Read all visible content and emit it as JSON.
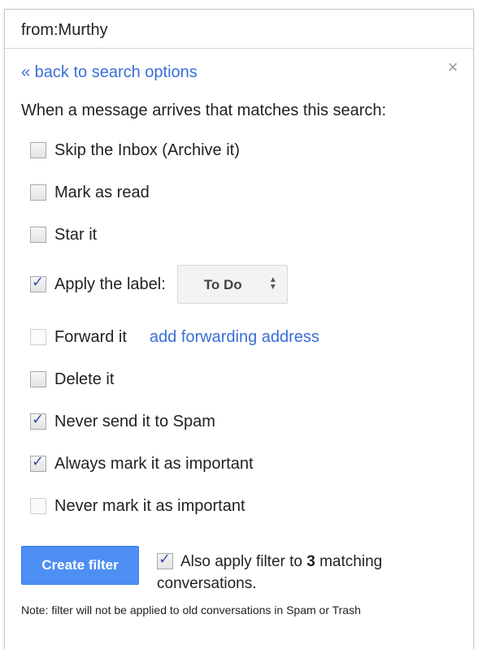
{
  "search": {
    "query": "from:Murthy"
  },
  "header": {
    "back_link": "« back to search options",
    "close_glyph": "×"
  },
  "intro_text": "When a message arrives that matches this search:",
  "options": [
    {
      "label": "Skip the Inbox (Archive it)",
      "checked": false
    },
    {
      "label": "Mark as read",
      "checked": false
    },
    {
      "label": "Star it",
      "checked": false
    },
    {
      "label": "Apply the label:",
      "checked": true
    },
    {
      "label": "Forward it",
      "checked": false,
      "link": "add forwarding address"
    },
    {
      "label": "Delete it",
      "checked": false
    },
    {
      "label": "Never send it to Spam",
      "checked": true
    },
    {
      "label": "Always mark it as important",
      "checked": true
    },
    {
      "label": "Never mark it as important",
      "checked": false
    }
  ],
  "label_select": {
    "value": "To Do"
  },
  "footer": {
    "create_button": "Create filter",
    "apply_prefix": "Also apply filter to",
    "apply_count": "3",
    "apply_suffix": "matching conversations.",
    "apply_checked": true,
    "note": "Note: filter will not be applied to old conversations in Spam or Trash"
  },
  "colors": {
    "link": "#3a6ed8",
    "primary_button": "#4d8ff3",
    "checkmark": "#3c4fa8"
  }
}
